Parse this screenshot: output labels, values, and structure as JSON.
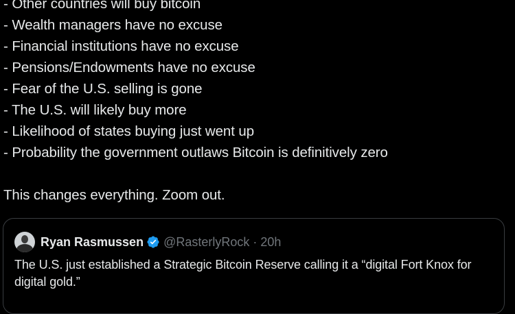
{
  "tweet": {
    "bullets": [
      "- Other countries will buy bitcoin",
      "- Wealth managers have no excuse",
      "- Financial institutions have no excuse",
      "- Pensions/Endowments have no excuse",
      "- Fear of the U.S. selling is gone",
      "- The U.S. will likely buy more",
      "- Likelihood of states buying just went up",
      "- Probability the government outlaws Bitcoin is definitively zero"
    ],
    "closing": "This changes everything. Zoom out."
  },
  "quote": {
    "author_name": "Ryan Rasmussen",
    "author_handle": "@RasterlyRock",
    "separator": "·",
    "time_ago": "20h",
    "text": "The U.S. just established a Strategic Bitcoin Reserve calling it a “digital Fort Knox for digital gold.”"
  },
  "icons": {
    "verified": "verified-badge-icon",
    "avatar": "user-avatar"
  },
  "colors": {
    "background": "#000000",
    "text_primary": "#e7e9ea",
    "text_secondary": "#71767b",
    "verified_blue": "#1d9bf0",
    "card_border": "#3a3d41"
  }
}
